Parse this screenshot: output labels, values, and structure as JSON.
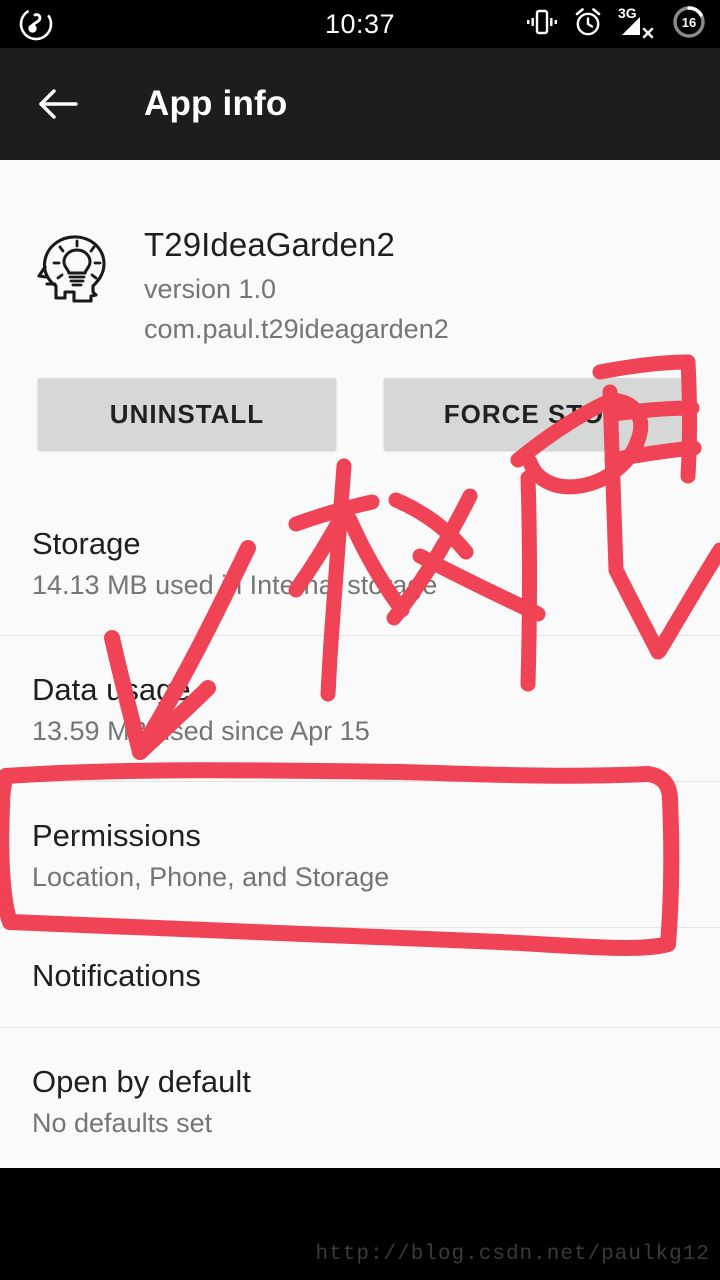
{
  "status_bar": {
    "clock": "10:37",
    "left_icon": "music-note-icon",
    "icons": [
      {
        "name": "vibrate-icon",
        "label": "Vibrate"
      },
      {
        "name": "alarm-clock-icon",
        "label": "Alarm set"
      },
      {
        "name": "signal-3g-icon",
        "label": "3G"
      },
      {
        "name": "battery-icon",
        "label": "16"
      }
    ],
    "battery_level": "16",
    "network_type": "3G"
  },
  "app_bar": {
    "title": "App info",
    "back_icon": "back-arrow-icon",
    "background": "#1d1d1d"
  },
  "app_header": {
    "icon": "head-lightbulb-idea-icon",
    "name": "T29IdeaGarden2",
    "version": "version 1.0",
    "package": "com.paul.t29ideagarden2"
  },
  "buttons": {
    "uninstall": "UNINSTALL",
    "force_stop": "FORCE STOP",
    "background": "#d6d7d7"
  },
  "settings_rows": [
    {
      "name": "storage",
      "title": "Storage",
      "subtitle": "14.13 MB used in Internal storage"
    },
    {
      "name": "data-usage",
      "title": "Data usage",
      "subtitle": "13.59 MB used since Apr 15"
    },
    {
      "name": "permissions",
      "title": "Permissions",
      "subtitle": "Location, Phone, and Storage"
    },
    {
      "name": "notifications",
      "title": "Notifications",
      "subtitle": ""
    },
    {
      "name": "open-by-default",
      "title": "Open by default",
      "subtitle": "No defaults set"
    }
  ],
  "annotations": {
    "stroke_color": "#f04355",
    "handwritten_text": "权限",
    "handwritten_meaning": "permissions",
    "arrow": "arrow-pointing-down-left",
    "highlight_box_target": "permissions"
  },
  "watermark": {
    "text": "http://blog.csdn.net/paulkg12"
  },
  "colors": {
    "sheet_background": "#fafafa",
    "primary_text": "#1f1f1f",
    "secondary_text": "#757575",
    "divider": "#e4e4e4",
    "system_black": "#000000",
    "annotation_red": "#f04355"
  }
}
